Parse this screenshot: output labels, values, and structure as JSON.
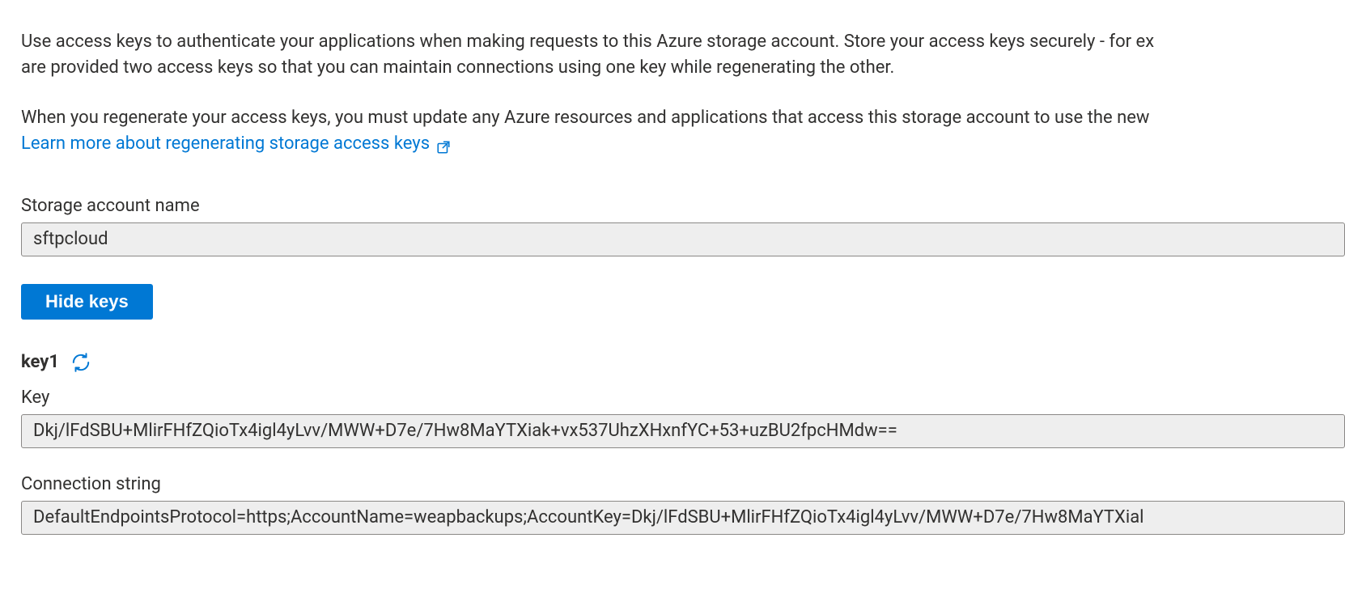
{
  "intro": {
    "line1": "Use access keys to authenticate your applications when making requests to this Azure storage account. Store your access keys securely - for ex",
    "line2": "are provided two access keys so that you can maintain connections using one key while regenerating the other.",
    "line3": "When you regenerate your access keys, you must update any Azure resources and applications that access this storage account to use the new",
    "learn_more": "Learn more about regenerating storage access keys"
  },
  "storage_account": {
    "label": "Storage account name",
    "value": "sftpcloud"
  },
  "toggle_button": {
    "label": "Hide keys"
  },
  "key1": {
    "heading": "key1",
    "key_label": "Key",
    "key_value": "Dkj/lFdSBU+MlirFHfZQioTx4igl4yLvv/MWW+D7e/7Hw8MaYTXiak+vx537UhzXHxnfYC+53+uzBU2fpcHMdw==",
    "conn_label": "Connection string",
    "conn_value": "DefaultEndpointsProtocol=https;AccountName=weapbackups;AccountKey=Dkj/lFdSBU+MlirFHfZQioTx4igl4yLvv/MWW+D7e/7Hw8MaYTXial"
  }
}
